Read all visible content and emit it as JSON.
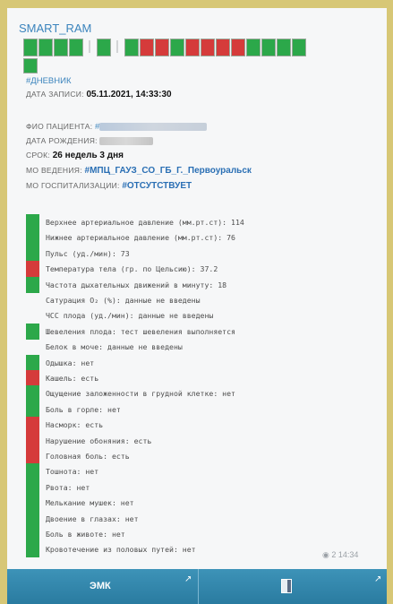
{
  "bot_name": "SMART_RAM",
  "status_strip": [
    {
      "c": "g"
    },
    {
      "c": "g"
    },
    {
      "c": "g"
    },
    {
      "c": "g"
    },
    {
      "c": "sep"
    },
    {
      "c": "g"
    },
    {
      "c": "sep"
    },
    {
      "c": "g"
    },
    {
      "c": "r"
    },
    {
      "c": "r"
    },
    {
      "c": "g"
    },
    {
      "c": "r"
    },
    {
      "c": "r"
    },
    {
      "c": "r"
    },
    {
      "c": "r"
    },
    {
      "c": "g"
    },
    {
      "c": "g"
    },
    {
      "c": "g"
    },
    {
      "c": "g"
    }
  ],
  "post": {
    "hashtag": "#ДНЕВНИК",
    "record_label": "ДАТА ЗАПИСИ:",
    "record_value": "05.11.2021, 14:33:30",
    "patient_label": "ФИО ПАЦИЕНТА:",
    "patient_prefix": "#",
    "birth_label": "ДАТА РОЖДЕНИЯ:",
    "term_label": "СРОК:",
    "term_value": "26 недель 3 дня",
    "management_label": "МО ВЕДЕНИЯ:",
    "management_value": "#МПЦ_ГАУЗ_СО_ГБ_Г._Первоуральск",
    "hospital_label": "МО ГОСПИТАЛИЗАЦИИ:",
    "hospital_value": "#ОТСУТСТВУЕТ"
  },
  "parameters": [
    {
      "status": "g",
      "text": "Верхнее артериальное давление (мм.рт.ст): 114"
    },
    {
      "status": "g",
      "text": "Нижнее артериальное давление (мм.рт.ст): 76"
    },
    {
      "status": "g",
      "text": "Пульс (уд./мин): 73"
    },
    {
      "status": "r",
      "text": "Температура тела (гр. по Цельсию): 37.2"
    },
    {
      "status": "g",
      "text": "Частота дыхательных движений в минуту: 18"
    },
    {
      "status": "n",
      "text": "Сатурация O₂ (%): данные не введены"
    },
    {
      "status": "n",
      "text": "ЧСС плода (уд./мин): данные не введены"
    },
    {
      "status": "g",
      "text": "Шевеления плода: тест шевеления выполняется"
    },
    {
      "status": "n",
      "text": "Белок в моче: данные не введены"
    },
    {
      "status": "g",
      "text": "Одышка: нет"
    },
    {
      "status": "r",
      "text": "Кашель: есть"
    },
    {
      "status": "g",
      "text": "Ощущение заложенности в грудной клетке: нет"
    },
    {
      "status": "g",
      "text": "Боль в горле: нет"
    },
    {
      "status": "r",
      "text": "Насморк: есть"
    },
    {
      "status": "r",
      "text": "Нарушение обоняния: есть"
    },
    {
      "status": "r",
      "text": "Головная боль: есть"
    },
    {
      "status": "g",
      "text": "Тошнота: нет"
    },
    {
      "status": "g",
      "text": "Рвота: нет"
    },
    {
      "status": "g",
      "text": "Мелькание мушек: нет"
    },
    {
      "status": "g",
      "text": "Двоение в глазах: нет"
    },
    {
      "status": "g",
      "text": "Боль в животе: нет"
    },
    {
      "status": "g",
      "text": "Кровотечение из половых путей: нет"
    }
  ],
  "message_meta": {
    "views": "2",
    "time": "14:34"
  },
  "buttons": [
    {
      "label": "ЭМК",
      "arrow": "↗"
    },
    {
      "label": "",
      "arrow": "↗"
    }
  ]
}
